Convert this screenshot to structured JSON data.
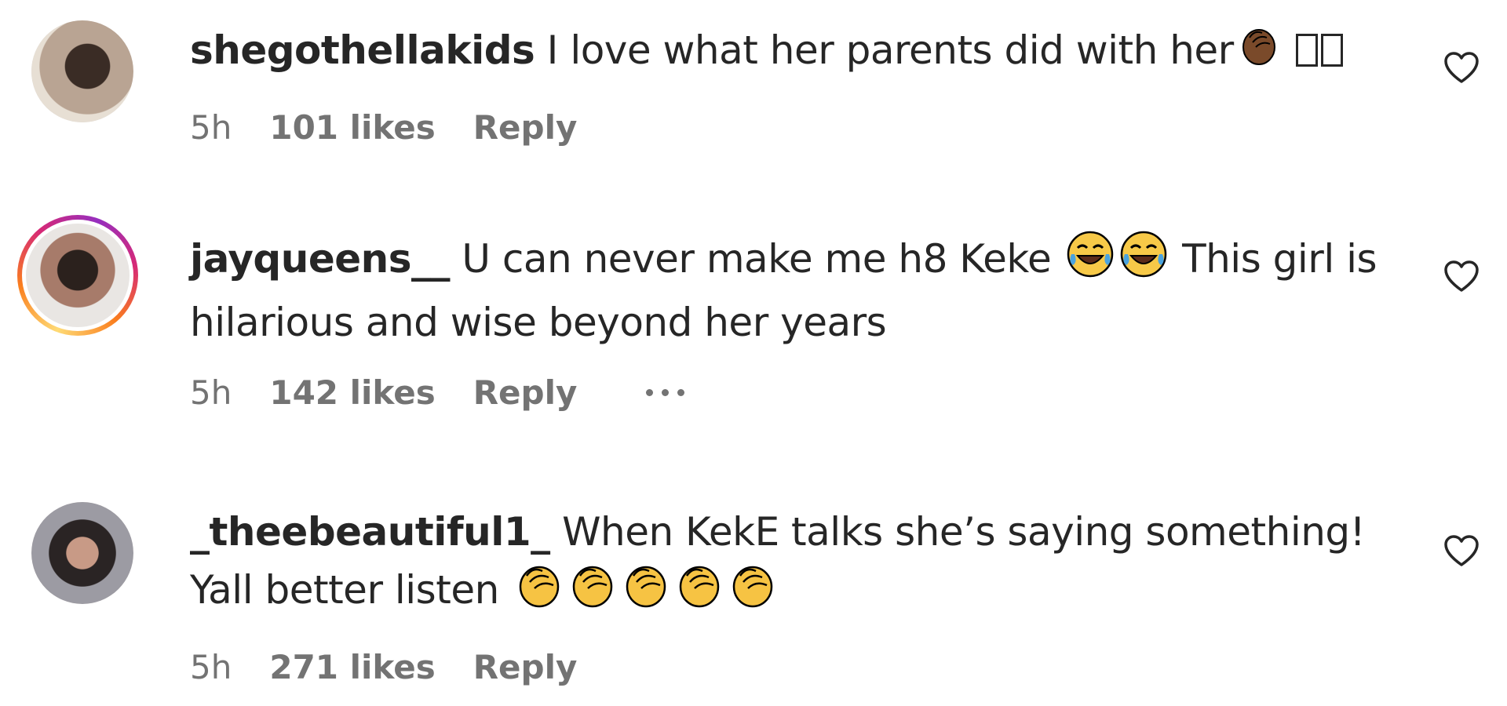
{
  "comments": [
    {
      "username": "shegothellakids",
      "text_before": " I love what her parents did with her",
      "text_after": "",
      "emoji_icons": [
        "clapping-hands-dark-skin-icon"
      ],
      "trailing_missing_glyphs": 2,
      "time": "5h",
      "likes": "101 likes",
      "reply": "Reply",
      "story_ring": false
    },
    {
      "username": "jayqueens__",
      "text_before": " U can never make me h8 Keke ",
      "text_after": " This girl is hilarious and wise beyond her years",
      "emoji_icons": [
        "face-with-tears-of-joy-icon",
        "face-with-tears-of-joy-icon"
      ],
      "time": "5h",
      "likes": "142 likes",
      "reply": "Reply",
      "story_ring": true
    },
    {
      "username": "_theebeautiful1_",
      "text_before": " When KekE talks she’s saying something! Yall better listen ",
      "text_after": "",
      "emoji_icons": [
        "clapping-hands-icon",
        "clapping-hands-icon",
        "clapping-hands-icon",
        "clapping-hands-icon",
        "clapping-hands-icon"
      ],
      "time": "5h",
      "likes": "271 likes",
      "reply": "Reply",
      "story_ring": false
    }
  ],
  "colors": {
    "text": "#262626",
    "meta": "#737373",
    "clap_dark": "#7a4a2a",
    "clap_yellow": "#f6c343",
    "laugh_yellow": "#f7c948",
    "tear_blue": "#4aa3df"
  }
}
